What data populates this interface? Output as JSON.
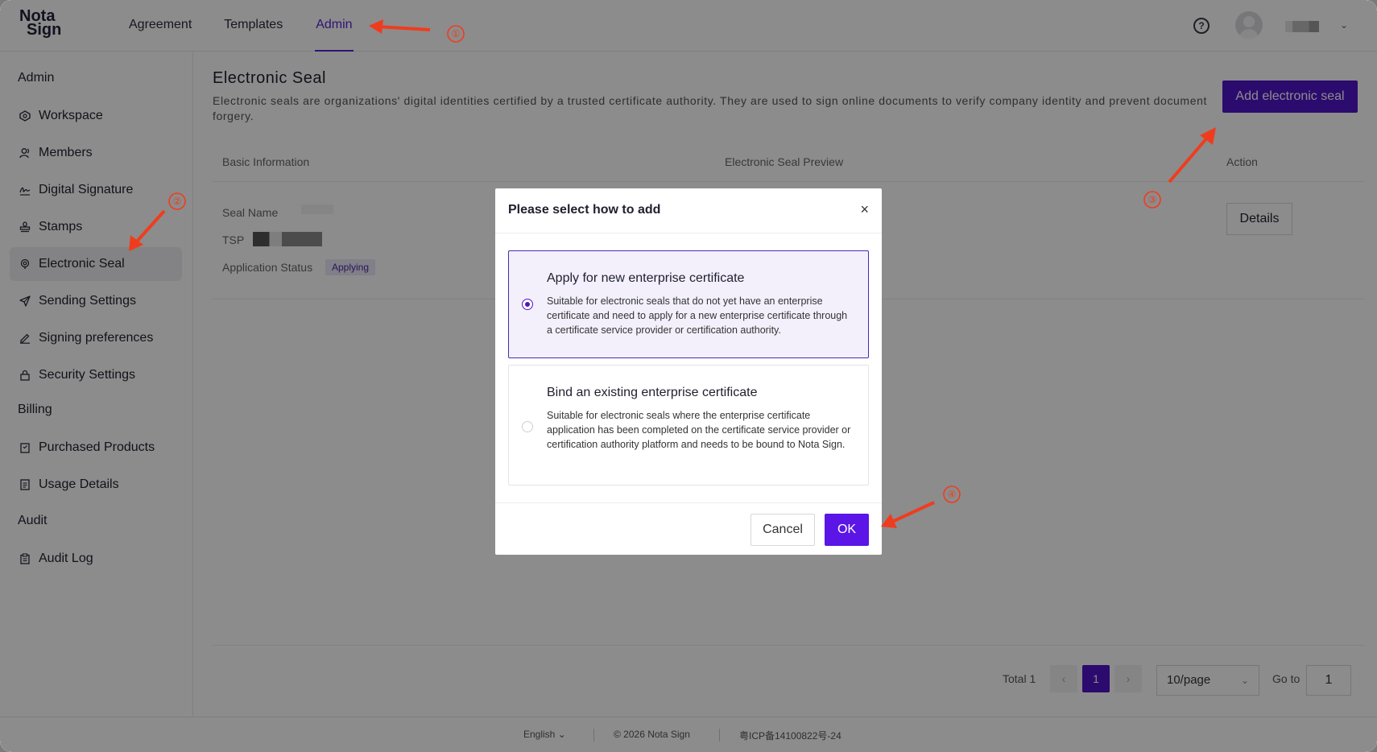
{
  "logo": {
    "line1": "Nota",
    "line2a": "",
    "line2b": "Sign"
  },
  "nav": {
    "tabs": [
      {
        "label": "Agreement"
      },
      {
        "label": "Templates"
      },
      {
        "label": "Admin"
      }
    ],
    "active": "Admin"
  },
  "header": {
    "help_icon": "?",
    "user_chevron": "⌄"
  },
  "sidebar": {
    "sections": [
      {
        "title": "Admin"
      },
      {
        "title": "Billing"
      },
      {
        "title": "Audit"
      }
    ],
    "items": [
      {
        "label": "Workspace",
        "icon": "workspace-icon"
      },
      {
        "label": "Members",
        "icon": "members-icon"
      },
      {
        "label": "Digital Signature",
        "icon": "signature-icon"
      },
      {
        "label": "Stamps",
        "icon": "stamp-icon"
      },
      {
        "label": "Electronic Seal",
        "icon": "seal-icon"
      },
      {
        "label": "Sending Settings",
        "icon": "send-icon"
      },
      {
        "label": "Signing preferences",
        "icon": "pen-icon"
      },
      {
        "label": "Security Settings",
        "icon": "lock-icon"
      },
      {
        "label": "Purchased Products",
        "icon": "box-icon"
      },
      {
        "label": "Usage Details",
        "icon": "list-icon"
      },
      {
        "label": "Audit Log",
        "icon": "clipboard-icon"
      }
    ],
    "active": "Electronic Seal"
  },
  "main": {
    "title": "Electronic Seal",
    "description": "Electronic seals are organizations' digital identities certified by a trusted certificate authority. They are used to sign online documents to verify company identity and prevent document forgery.",
    "add_button": "Add electronic seal",
    "table": {
      "headers": [
        "Basic Information",
        "Electronic Seal Preview",
        "Action"
      ],
      "row": {
        "seal_name_label": "Seal Name",
        "tsp_label": "TSP",
        "status_label": "Application Status",
        "status_value": "Applying",
        "action": "Details"
      }
    },
    "pagination": {
      "total": "Total 1",
      "prev": "‹",
      "current": "1",
      "next": "›",
      "page_size": "10/page",
      "goto_label": "Go to",
      "goto_value": "1"
    }
  },
  "footer": {
    "language": "English",
    "copyright": "© 2026 Nota Sign",
    "icp": "粤ICP备14100822号-24"
  },
  "modal": {
    "title": "Please select how to add",
    "close": "×",
    "options": [
      {
        "title": "Apply for new enterprise certificate",
        "description": "Suitable for electronic seals that do not yet have an enterprise certificate and need to apply for a new enterprise certificate through a certificate service provider or certification authority.",
        "selected": true
      },
      {
        "title": "Bind an existing enterprise certificate",
        "description": "Suitable for electronic seals where the enterprise certificate application has been completed on the certificate service provider or certification authority platform and needs to be bound to Nota Sign.",
        "selected": false
      }
    ],
    "cancel": "Cancel",
    "ok": "OK"
  },
  "annotations": {
    "color": "#f03c1e",
    "markers": [
      "①",
      "②",
      "③",
      "④"
    ]
  },
  "colors": {
    "accent": "#5015c8",
    "ok": "#5b15e6"
  }
}
